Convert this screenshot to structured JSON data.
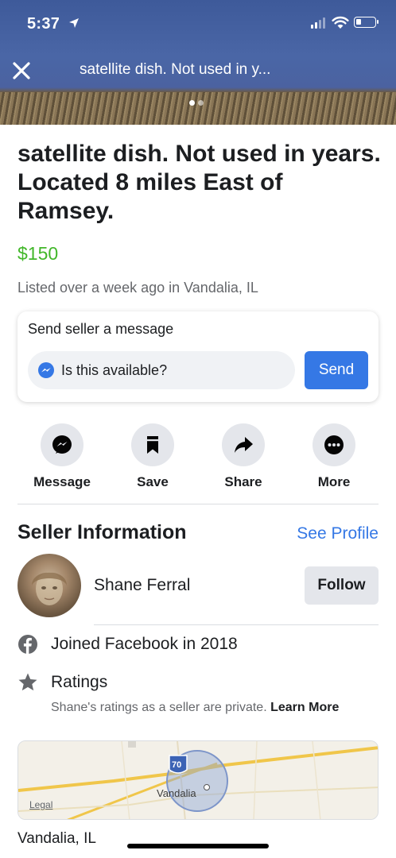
{
  "status_bar": {
    "time": "5:37"
  },
  "header": {
    "title": "satellite dish. Not used in y..."
  },
  "listing": {
    "title": "satellite dish. Not used in years. Located 8 miles East of Ramsey.",
    "price": "$150",
    "listed": "Listed over a week ago in Vandalia, IL"
  },
  "message_card": {
    "label": "Send seller a message",
    "input_value": "Is this available?",
    "send_label": "Send"
  },
  "actions": [
    {
      "label": "Message",
      "icon": "messenger-icon"
    },
    {
      "label": "Save",
      "icon": "bookmark-icon"
    },
    {
      "label": "Share",
      "icon": "share-arrow-icon"
    },
    {
      "label": "More",
      "icon": "more-dots-icon"
    }
  ],
  "seller": {
    "heading": "Seller Information",
    "see_profile": "See Profile",
    "name": "Shane Ferral",
    "follow_label": "Follow",
    "joined": "Joined Facebook in 2018",
    "ratings_label": "Ratings",
    "ratings_desc": "Shane's ratings as a seller are private.",
    "learn_more": "Learn More"
  },
  "map": {
    "legal": "Legal",
    "town_label": "Vandalia",
    "shield": "70"
  },
  "location": {
    "city": "Vandalia, IL"
  },
  "colors": {
    "accent": "#3578e5",
    "price": "#42b72a",
    "header_blue": "#4a66a6"
  }
}
